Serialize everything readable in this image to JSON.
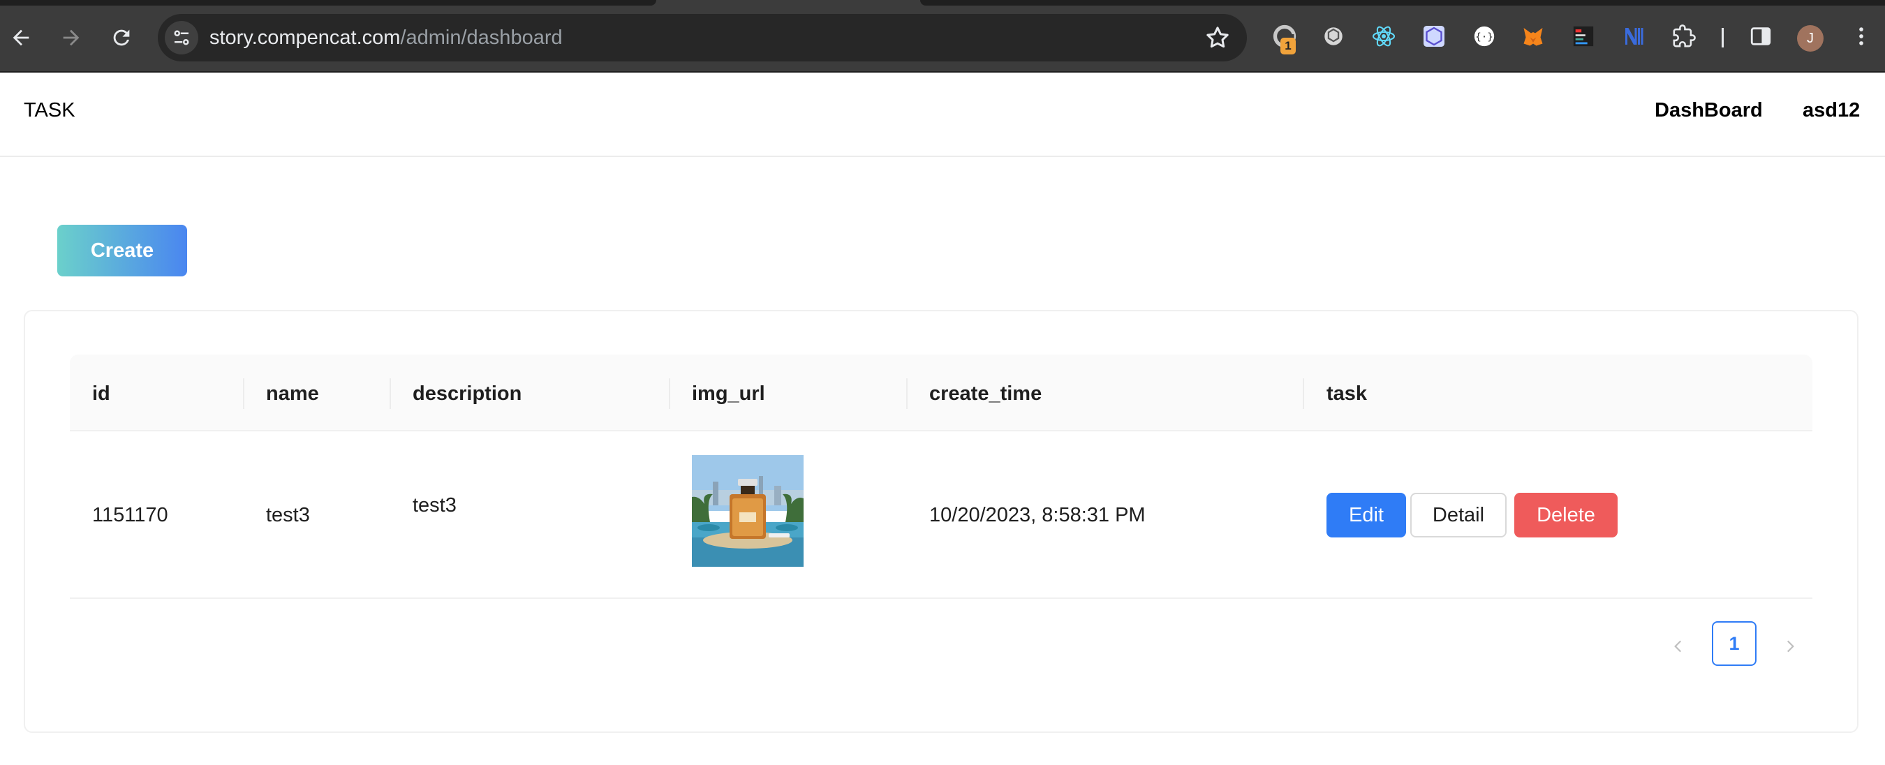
{
  "browser": {
    "url_host": "story.compencat.com",
    "url_path": "/admin/dashboard",
    "extension_badge": "1",
    "profile_initial": "J",
    "icons": [
      "back-arrow-icon",
      "forward-arrow-icon",
      "reload-icon",
      "site-settings-icon",
      "bookmark-star-icon",
      "extension-icon",
      "side-panel-icon"
    ]
  },
  "header": {
    "brand": "TASK",
    "nav": {
      "dashboard": "DashBoard",
      "user": "asd12"
    }
  },
  "toolbar": {
    "create_label": "Create"
  },
  "table": {
    "columns": [
      "id",
      "name",
      "description",
      "img_url",
      "create_time",
      "task"
    ],
    "rows": [
      {
        "id": "1151170",
        "name": "test3",
        "description": "test3",
        "create_time": "10/20/2023, 8:58:31 PM",
        "actions": {
          "edit": "Edit",
          "detail": "Detail",
          "delete": "Delete"
        }
      }
    ]
  },
  "pagination": {
    "current_page": "1"
  },
  "colors": {
    "primary": "#2f7cf6",
    "danger": "#ef5b5b",
    "create_gradient_start": "#6bd0cb",
    "create_gradient_end": "#4a86f0"
  }
}
